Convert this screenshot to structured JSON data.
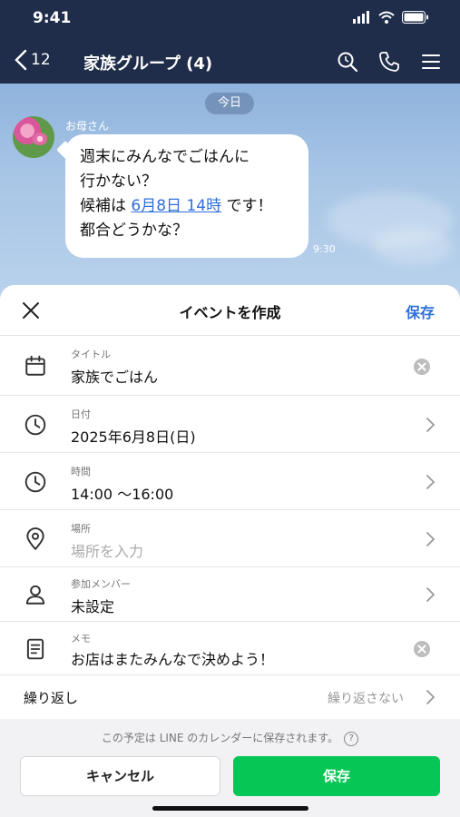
{
  "status": {
    "time": "9:41"
  },
  "nav": {
    "back_count": "12",
    "title": "家族グループ (4)"
  },
  "chat": {
    "date_label": "今日",
    "sender": "お母さん",
    "message_line1": "週末にみんなでごはんに",
    "message_line2": "行かない？",
    "message_prefix": "候補は ",
    "message_link": "6月8日 14時",
    "message_suffix": " です！",
    "message_line4": "都合どうかな？",
    "time": "9:30"
  },
  "sheet": {
    "title": "イベントを作成",
    "save_label": "保存",
    "rows": [
      {
        "label": "タイトル",
        "value": "家族でごはん",
        "icon": "calendar-icon"
      },
      {
        "label": "日付",
        "value": "2025年6月8日(日)",
        "icon": "clock-icon"
      },
      {
        "label": "時間",
        "value": "14:00 ～16:00",
        "icon": "clock-icon"
      },
      {
        "label": "場所",
        "placeholder": "場所を入力",
        "icon": "location-pin-icon"
      },
      {
        "label": "参加メンバー",
        "value": "未設定",
        "icon": "person-icon"
      },
      {
        "label": "メモ",
        "value": "お店はまたみんなで決めよう！",
        "icon": "memo-icon"
      }
    ],
    "repeat_label": "繰り返し",
    "repeat_value": "繰り返さない",
    "footer_note": "この予定は LINE のカレンダーに保存されます。",
    "help_glyph": "?",
    "cancel_label": "キャンセル",
    "confirm_label": "保存"
  },
  "colors": {
    "nav_bg": "#1f2d4a",
    "link": "#2e6fd9",
    "save_green": "#06c755"
  }
}
